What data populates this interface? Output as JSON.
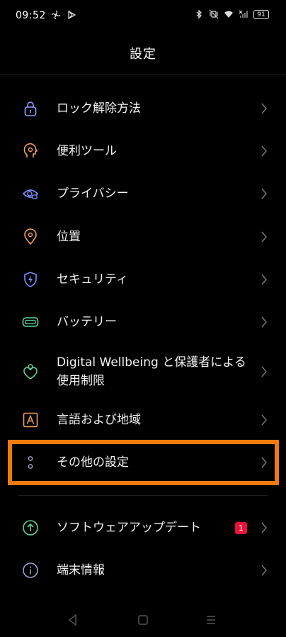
{
  "status": {
    "time": "09:52",
    "battery": "91"
  },
  "header": {
    "title": "設定"
  },
  "settings": {
    "items": [
      {
        "label": "ロック解除方法",
        "icon": "lock-icon",
        "color": "#8fa3ff"
      },
      {
        "label": "便利ツール",
        "icon": "tools-head-icon",
        "color": "#f2a05a"
      },
      {
        "label": "プライバシー",
        "icon": "privacy-eye-icon",
        "color": "#7f8dff"
      },
      {
        "label": "位置",
        "icon": "location-pin-icon",
        "color": "#f2a05a"
      },
      {
        "label": "セキュリティ",
        "icon": "security-shield-icon",
        "color": "#7f8dff"
      },
      {
        "label": "バッテリー",
        "icon": "battery-icon",
        "color": "#5fd39b"
      },
      {
        "label": "Digital Wellbeing と保護者による使用制限",
        "icon": "wellbeing-heart-icon",
        "color": "#5fd39b"
      },
      {
        "label": "言語および地域",
        "icon": "language-icon",
        "color": "#f2a05a"
      },
      {
        "label": "その他の設定",
        "icon": "more-settings-icon",
        "color": "#9aa3c8"
      },
      {
        "label": "ソフトウェアアップデート",
        "icon": "update-arrow-icon",
        "color": "#5fd39b",
        "badge": "1"
      },
      {
        "label": "端末情報",
        "icon": "info-icon",
        "color": "#9aa3c8"
      }
    ]
  },
  "colors": {
    "highlight": "#f07a0c",
    "badge": "#e8123a"
  }
}
